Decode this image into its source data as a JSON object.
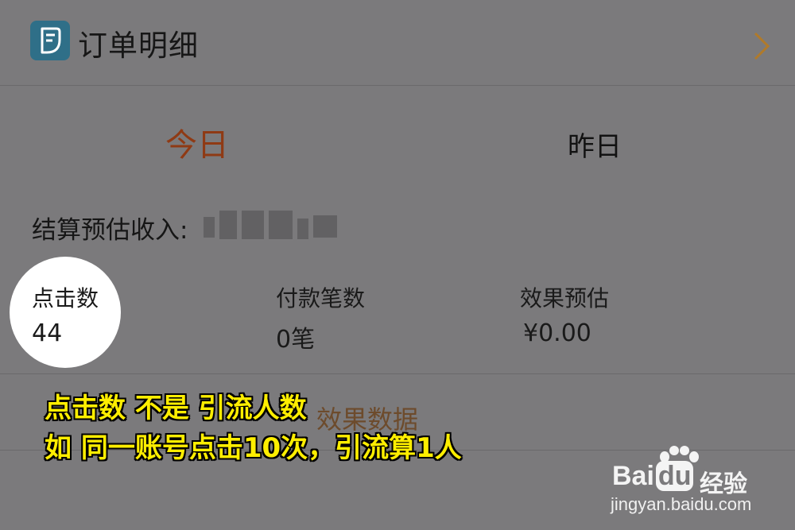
{
  "header": {
    "title": "订单明细",
    "icon": "document-icon",
    "chevron": "chevron-right-icon"
  },
  "tabs": {
    "today": "今日",
    "yesterday": "昨日"
  },
  "income": {
    "label": "结算预估收入:"
  },
  "stats": {
    "clicks": {
      "label": "点击数",
      "value": "44"
    },
    "payments": {
      "label": "付款笔数",
      "value": "0笔"
    },
    "estimate": {
      "label": "效果预估",
      "value": "¥0.00"
    }
  },
  "effect_link": "效果数据",
  "caption": {
    "line1": "点击数 不是 引流人数",
    "line2": "如 同一账号点击10次，引流算1人"
  },
  "watermark": {
    "brand": "Bai",
    "brand2": "du",
    "brand_cn": "经验",
    "url": "jingyan.baidu.com"
  },
  "colors": {
    "background": "#7b7a7c",
    "accent_active_tab": "#8f3a14",
    "caption": "#ffee00",
    "icon": "#2f6f88"
  }
}
